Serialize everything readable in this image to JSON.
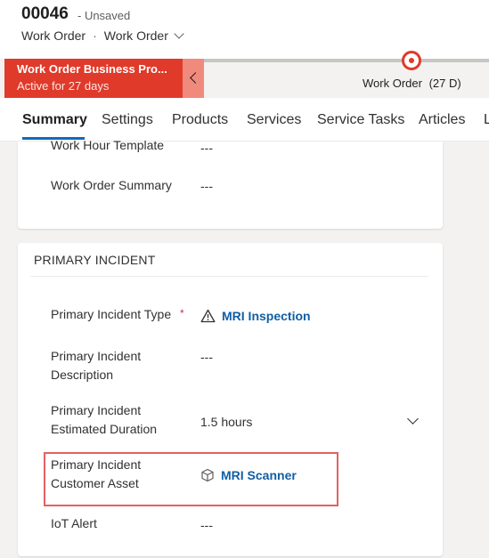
{
  "record": {
    "id": "00046",
    "status": "- Unsaved",
    "entity": "Work Order",
    "separator": "·",
    "form": "Work Order"
  },
  "bpf": {
    "title": "Work Order Business Pro...",
    "subtitle": "Active for 27 days",
    "stage_name": "Work Order",
    "stage_duration": "(27 D)",
    "accent": "#e03a2a"
  },
  "tabs": [
    {
      "label": "Summary",
      "active": true
    },
    {
      "label": "Settings"
    },
    {
      "label": "Products"
    },
    {
      "label": "Services"
    },
    {
      "label": "Service Tasks"
    },
    {
      "label": "Articles"
    },
    {
      "label": "L"
    }
  ],
  "general": {
    "work_hour_template_label": "Work Hour Template",
    "work_hour_template_value": "---",
    "summary_label": "Work Order Summary",
    "summary_value": "---"
  },
  "primary_incident": {
    "title": "PRIMARY INCIDENT",
    "type_label": "Primary Incident Type",
    "type_required": "*",
    "type_value": "MRI Inspection",
    "type_icon": "warning-triangle-icon",
    "description_label_1": "Primary Incident",
    "description_label_2": "Description",
    "description_value": "---",
    "duration_label_1": "Primary Incident",
    "duration_label_2": "Estimated Duration",
    "duration_value": "1.5 hours",
    "asset_label_1": "Primary Incident",
    "asset_label_2": "Customer Asset",
    "asset_value": "MRI Scanner",
    "asset_icon": "cube-icon",
    "iot_label": "IoT Alert",
    "iot_value": "---"
  }
}
